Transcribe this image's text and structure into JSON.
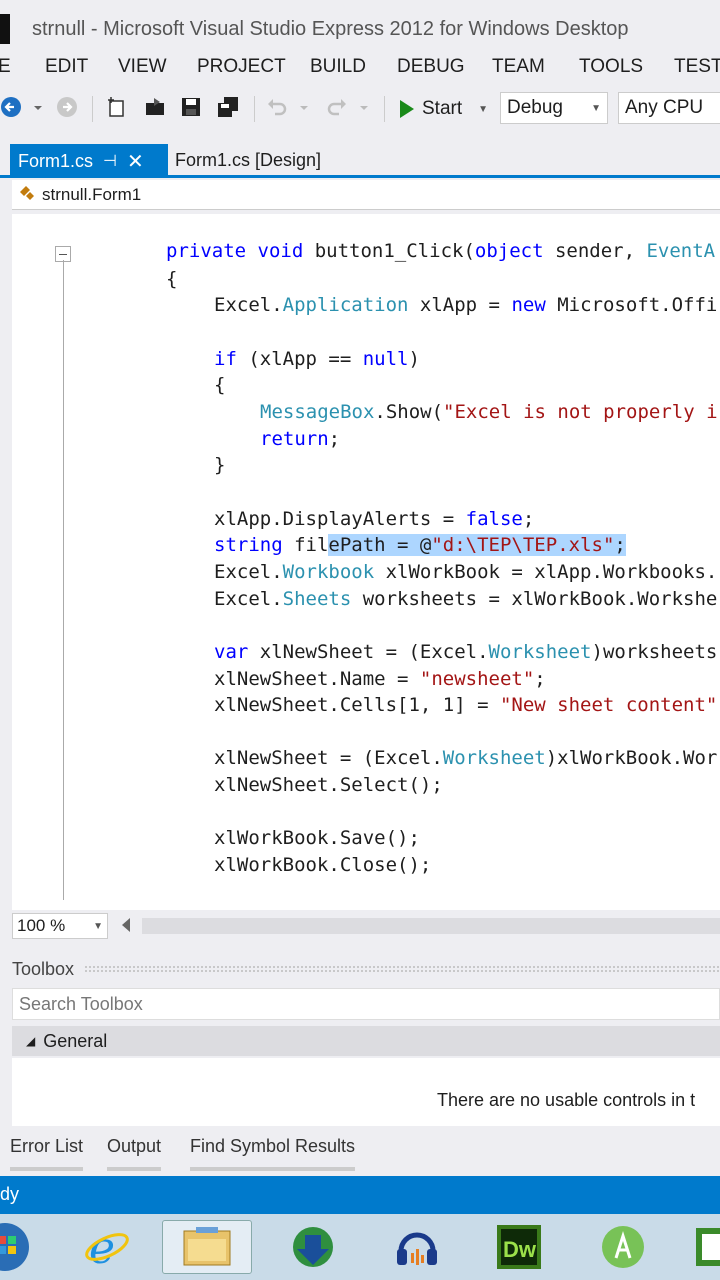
{
  "window": {
    "title": "strnull - Microsoft Visual Studio Express 2012 for Windows Desktop"
  },
  "menu": {
    "items": [
      "E",
      "EDIT",
      "VIEW",
      "PROJECT",
      "BUILD",
      "DEBUG",
      "TEAM",
      "TOOLS",
      "TEST"
    ]
  },
  "toolbar": {
    "start_label": "Start",
    "configuration": "Debug",
    "platform": "Any CPU"
  },
  "tabs": [
    {
      "label": "Form1.cs",
      "active": true
    },
    {
      "label": "Form1.cs [Design]",
      "active": false
    }
  ],
  "navbar": {
    "class_path": "strnull.Form1"
  },
  "code": {
    "lines": [
      "private void button1_Click(object sender, EventA",
      "{",
      "Excel.Application xlApp = new Microsoft.Offi",
      "if (xlApp == null)",
      "{",
      "MessageBox.Show(\"Excel is not properly i",
      "return;",
      "}",
      "xlApp.DisplayAlerts = false;",
      "string filePath = @\"d:\\TEP\\TEP.xls\";",
      "Excel.Workbook xlWorkBook = xlApp.Workbooks.",
      "Excel.Sheets worksheets = xlWorkBook.Workshe",
      "var xlNewSheet = (Excel.Worksheet)worksheets",
      "xlNewSheet.Name = \"newsheet\";",
      "xlNewSheet.Cells[1, 1] = \"New sheet content\"",
      "xlNewSheet = (Excel.Worksheet)xlWorkBook.Wor",
      "xlNewSheet.Select();",
      "xlWorkBook.Save();",
      "xlWorkBook.Close();"
    ]
  },
  "editor": {
    "zoom": "100 %"
  },
  "toolbox": {
    "title": "Toolbox",
    "search_placeholder": "Search Toolbox",
    "group": "General",
    "empty_message": "There are no usable controls in t"
  },
  "bottom_tabs": [
    "Error List",
    "Output",
    "Find Symbol Results"
  ],
  "status": {
    "text": "dy"
  },
  "colors": {
    "accent": "#007acc",
    "keyword": "#0000ff",
    "type": "#2b91af",
    "string": "#a31515",
    "selection": "#add6ff"
  }
}
